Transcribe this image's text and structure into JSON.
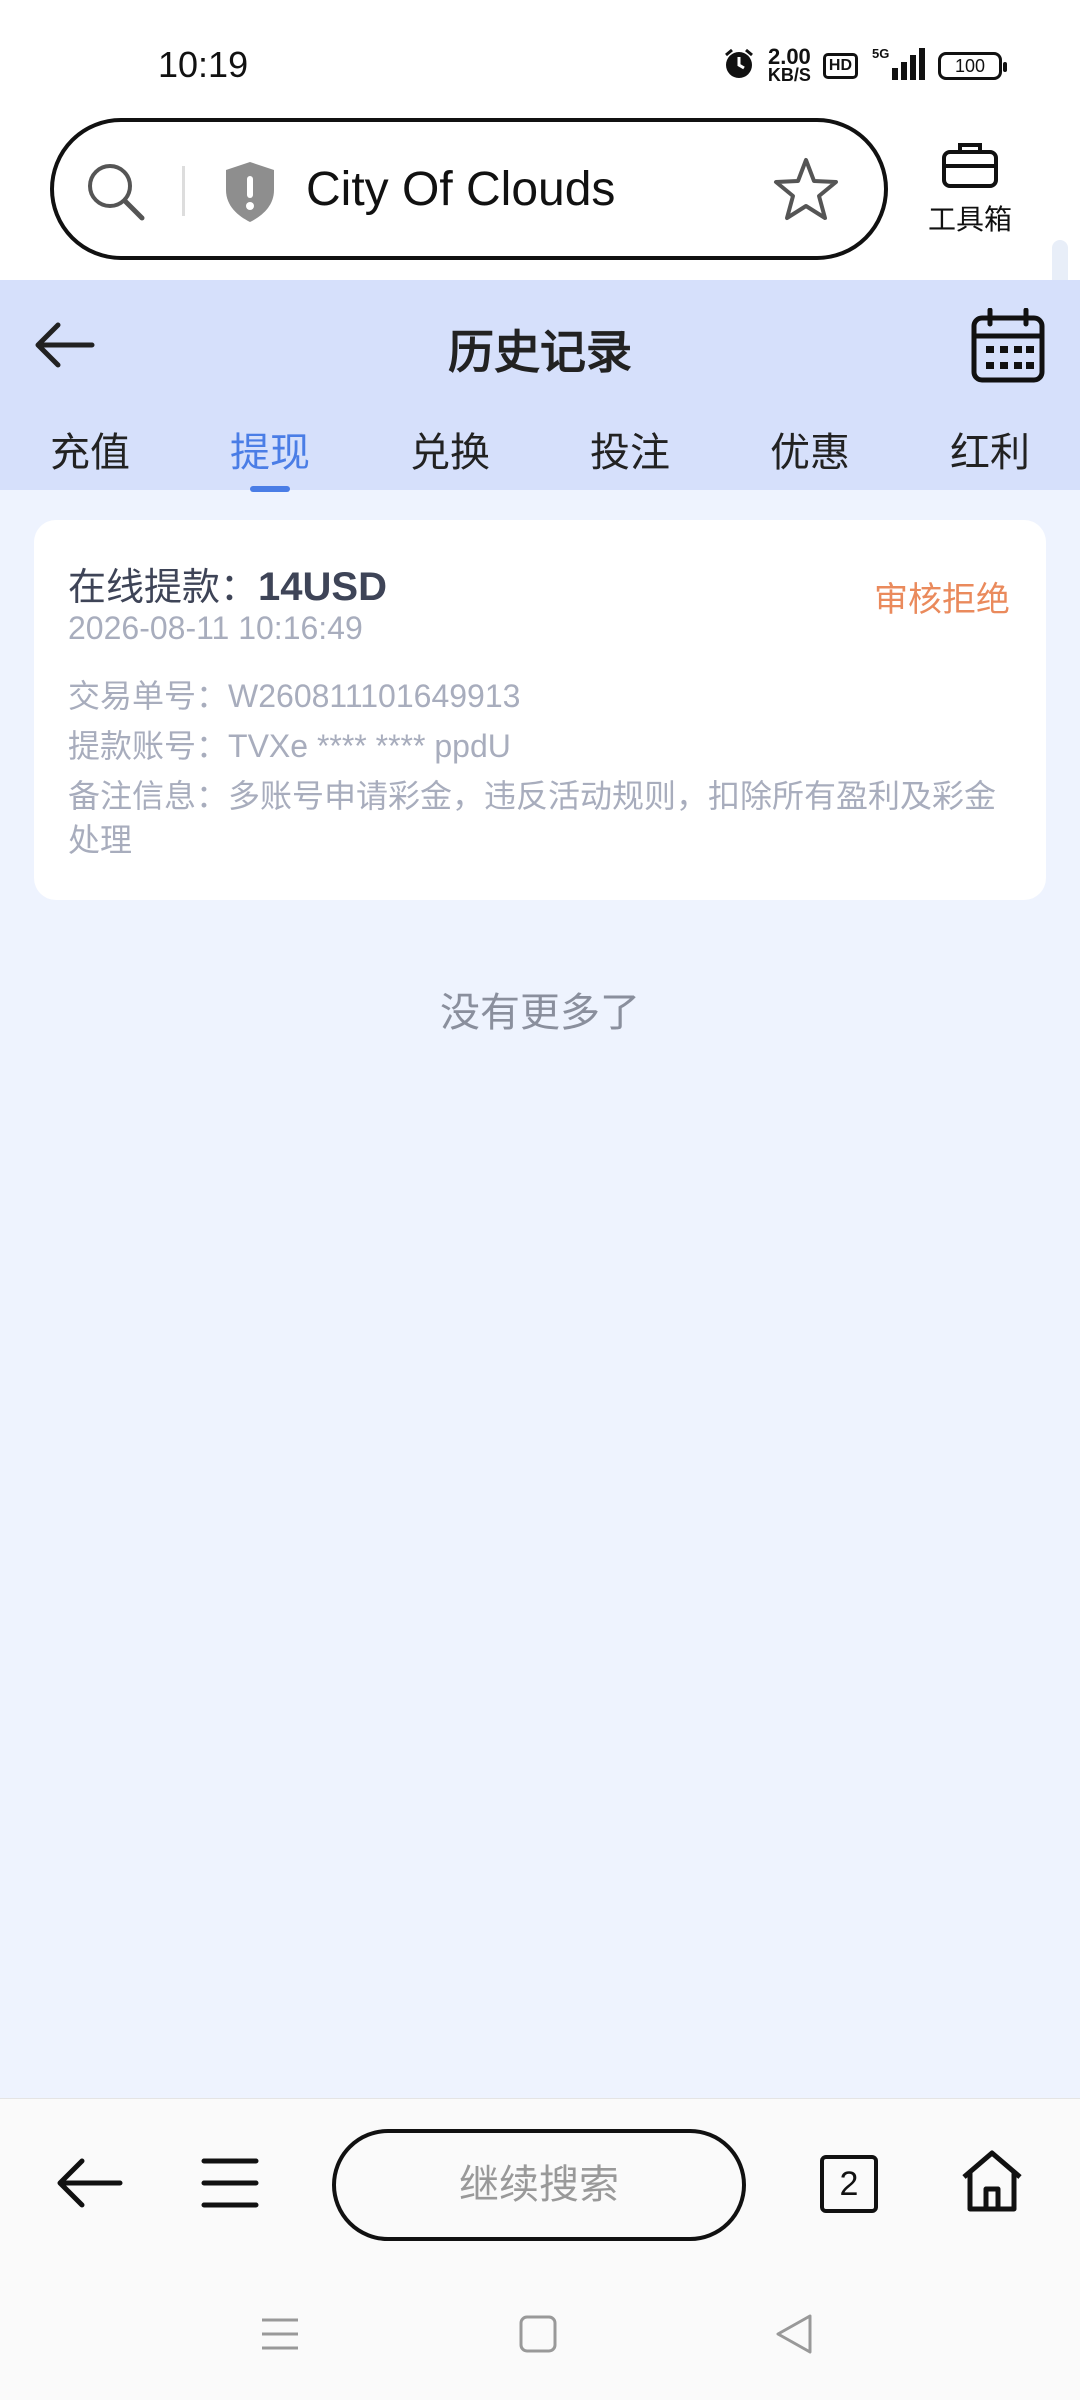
{
  "status_bar": {
    "time": "10:19",
    "speed_value": "2.00",
    "speed_unit": "KB/S",
    "hd_badge": "HD",
    "network": "5G",
    "battery": "100"
  },
  "browser": {
    "url_text": "City Of Clouds",
    "toolbox_label": "工具箱"
  },
  "header": {
    "title": "历史记录"
  },
  "tabs": [
    {
      "label": "充值"
    },
    {
      "label": "提现"
    },
    {
      "label": "兑换"
    },
    {
      "label": "投注"
    },
    {
      "label": "优惠"
    },
    {
      "label": "红利"
    }
  ],
  "active_tab_index": 1,
  "record": {
    "title_prefix": "在线提款：",
    "amount": "14USD",
    "status": "审核拒绝",
    "datetime": "2026-08-11 10:16:49",
    "order_label": "交易单号：",
    "order_value": "W260811101649913",
    "account_label": "提款账号：",
    "account_value": "TVXe **** **** ppdU",
    "note_label": "备注信息：",
    "note_value": "多账号申请彩金，违反活动规则，扣除所有盈利及彩金处理"
  },
  "list_end_text": "没有更多了",
  "bottom_nav": {
    "search_placeholder": "继续搜索",
    "tab_count": "2"
  },
  "colors": {
    "accent": "#4a7de6",
    "status_rejected": "#ea8a5c",
    "header_bg": "#d6e0fb",
    "page_bg": "#eef3fe"
  }
}
